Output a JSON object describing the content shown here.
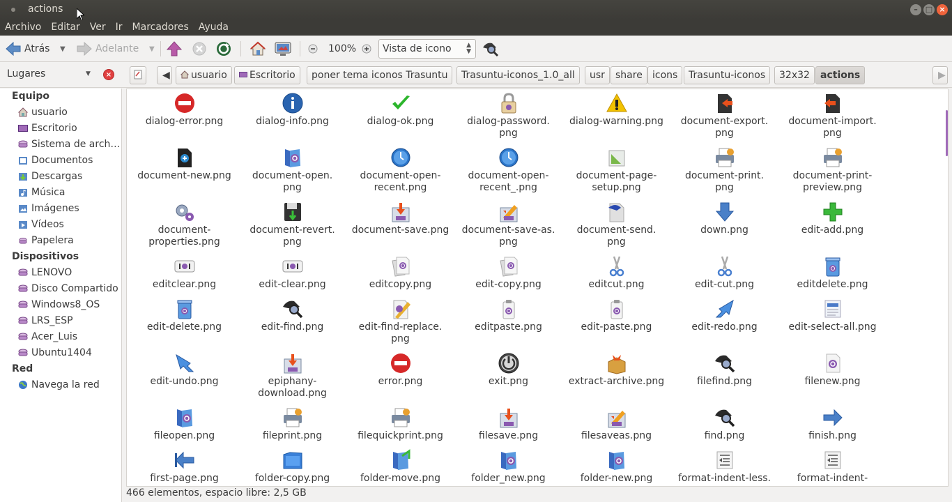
{
  "window": {
    "title": "actions"
  },
  "menu": [
    "Archivo",
    "Editar",
    "Ver",
    "Ir",
    "Marcadores",
    "Ayuda"
  ],
  "toolbar": {
    "back": "Atrás",
    "forward": "Adelante",
    "zoom": "100%",
    "view_mode": "Vista de icono"
  },
  "places": {
    "label": "Lugares"
  },
  "breadcrumbs": [
    "usuario",
    "Escritorio",
    "poner tema iconos Trasuntu",
    "Trasuntu-iconos_1.0_all",
    "usr",
    "share",
    "icons",
    "Trasuntu-iconos",
    "32x32",
    "actions"
  ],
  "sidebar": {
    "equipo": {
      "title": "Equipo",
      "items": [
        "usuario",
        "Escritorio",
        "Sistema de arch…",
        "Documentos",
        "Descargas",
        "Música",
        "Imágenes",
        "Vídeos",
        "Papelera"
      ]
    },
    "dispositivos": {
      "title": "Dispositivos",
      "items": [
        "LENOVO",
        "Disco Compartido",
        "Windows8_OS",
        "LRS_ESP",
        "Acer_Luis",
        "Ubuntu1404"
      ]
    },
    "red": {
      "title": "Red",
      "items": [
        "Navega la red"
      ]
    }
  },
  "files": [
    {
      "name": "dialog-error.png",
      "icon": "error"
    },
    {
      "name": "dialog-info.png",
      "icon": "info"
    },
    {
      "name": "dialog-ok.png",
      "icon": "ok"
    },
    {
      "name": "dialog-password.\npng",
      "icon": "lock"
    },
    {
      "name": "dialog-warning.png",
      "icon": "warning"
    },
    {
      "name": "document-export.\npng",
      "icon": "export"
    },
    {
      "name": "document-import.\npng",
      "icon": "import"
    },
    {
      "name": "document-new.png",
      "icon": "docnew"
    },
    {
      "name": "document-open.\npng",
      "icon": "folder"
    },
    {
      "name": "document-open-\nrecent.png",
      "icon": "clock"
    },
    {
      "name": "document-open-\nrecent_.png",
      "icon": "clock"
    },
    {
      "name": "document-page-\nsetup.png",
      "icon": "pagesetup"
    },
    {
      "name": "document-print.\npng",
      "icon": "printer"
    },
    {
      "name": "document-print-\npreview.png",
      "icon": "printer"
    },
    {
      "name": "document-\nproperties.png",
      "icon": "gears"
    },
    {
      "name": "document-revert.\npng",
      "icon": "revert"
    },
    {
      "name": "document-save.png",
      "icon": "save"
    },
    {
      "name": "document-save-as.\npng",
      "icon": "saveas"
    },
    {
      "name": "document-send.\npng",
      "icon": "send"
    },
    {
      "name": "down.png",
      "icon": "down"
    },
    {
      "name": "edit-add.png",
      "icon": "add"
    },
    {
      "name": "editclear.png",
      "icon": "clear"
    },
    {
      "name": "edit-clear.png",
      "icon": "clear"
    },
    {
      "name": "editcopy.png",
      "icon": "copy"
    },
    {
      "name": "edit-copy.png",
      "icon": "copy"
    },
    {
      "name": "editcut.png",
      "icon": "cut"
    },
    {
      "name": "edit-cut.png",
      "icon": "cut"
    },
    {
      "name": "editdelete.png",
      "icon": "trash"
    },
    {
      "name": "edit-delete.png",
      "icon": "trash"
    },
    {
      "name": "edit-find.png",
      "icon": "find"
    },
    {
      "name": "edit-find-replace.\npng",
      "icon": "findreplace"
    },
    {
      "name": "editpaste.png",
      "icon": "paste"
    },
    {
      "name": "edit-paste.png",
      "icon": "paste"
    },
    {
      "name": "edit-redo.png",
      "icon": "redo"
    },
    {
      "name": "edit-select-all.png",
      "icon": "selectall"
    },
    {
      "name": "edit-undo.png",
      "icon": "undo"
    },
    {
      "name": "epiphany-\ndownload.png",
      "icon": "save"
    },
    {
      "name": "error.png",
      "icon": "error"
    },
    {
      "name": "exit.png",
      "icon": "exit"
    },
    {
      "name": "extract-archive.png",
      "icon": "archive"
    },
    {
      "name": "filefind.png",
      "icon": "find"
    },
    {
      "name": "filenew.png",
      "icon": "page"
    },
    {
      "name": "fileopen.png",
      "icon": "folder"
    },
    {
      "name": "fileprint.png",
      "icon": "printer"
    },
    {
      "name": "filequickprint.png",
      "icon": "printer"
    },
    {
      "name": "filesave.png",
      "icon": "save"
    },
    {
      "name": "filesaveas.png",
      "icon": "saveas"
    },
    {
      "name": "find.png",
      "icon": "find"
    },
    {
      "name": "finish.png",
      "icon": "finish"
    },
    {
      "name": "first-page.png",
      "icon": "first"
    },
    {
      "name": "folder-copy.png",
      "icon": "foldercopy"
    },
    {
      "name": "folder-move.png",
      "icon": "foldermove"
    },
    {
      "name": "folder_new.png",
      "icon": "folder"
    },
    {
      "name": "folder-new.png",
      "icon": "folder"
    },
    {
      "name": "format-indent-less.",
      "icon": "indent"
    },
    {
      "name": "format-indent-",
      "icon": "indent"
    }
  ],
  "status": "466 elementos, espacio libre: 2,5 GB"
}
